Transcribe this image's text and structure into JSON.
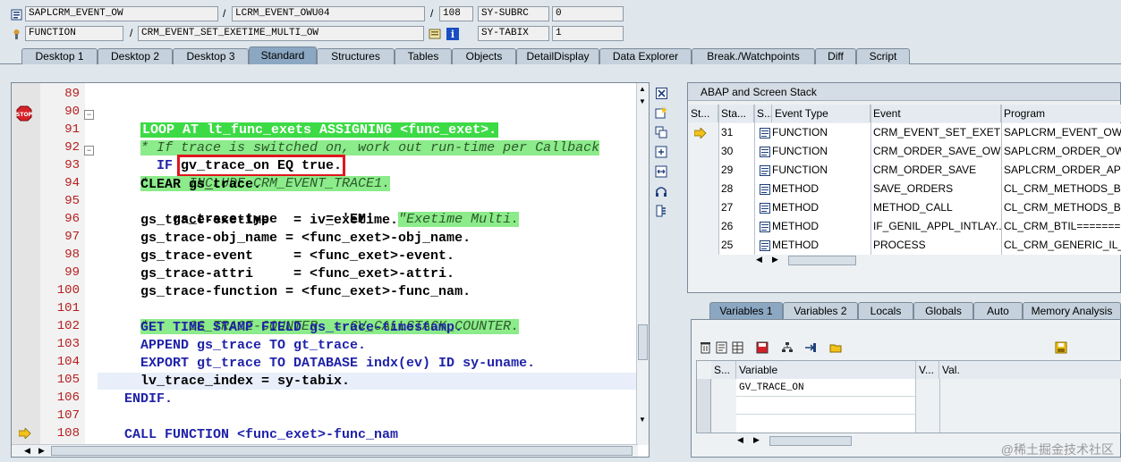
{
  "header": {
    "program": "SAPLCRM_EVENT_OW",
    "include": "LCRM_EVENT_OWU04",
    "line": "108",
    "sy_subrc_label": "SY-SUBRC",
    "sy_subrc_value": "0",
    "type": "FUNCTION",
    "function_name": "CRM_EVENT_SET_EXETIME_MULTI_OW",
    "sy_tabix_label": "SY-TABIX",
    "sy_tabix_value": "1",
    "slash": "/"
  },
  "tabs": [
    {
      "label": "Desktop 1"
    },
    {
      "label": "Desktop 2"
    },
    {
      "label": "Desktop 3"
    },
    {
      "label": "Standard"
    },
    {
      "label": "Structures"
    },
    {
      "label": "Tables"
    },
    {
      "label": "Objects"
    },
    {
      "label": "DetailDisplay"
    },
    {
      "label": "Data Explorer"
    },
    {
      "label": "Break./Watchpoints"
    },
    {
      "label": "Diff"
    },
    {
      "label": "Script"
    }
  ],
  "editor": {
    "lines": [
      {
        "num": "89",
        "code": ""
      },
      {
        "num": "90",
        "code": "LOOP AT lt_func_exets ASSIGNING <func_exet>."
      },
      {
        "num": "91",
        "code": "* If trace is switched on, work out run-time per Callback"
      },
      {
        "num": "92",
        "code_a": "  IF ",
        "code_b": "gv_trace_on EQ true."
      },
      {
        "num": "93",
        "code": "*     INCLUDE CRM_EVENT_TRACE1."
      },
      {
        "num": "94",
        "code": "    CLEAR gs_trace."
      },
      {
        "num": "95",
        "code_a": "    gs_trace-type      = 'EM'.  ",
        "code_b": "\"Exetime Multi."
      },
      {
        "num": "96",
        "code": "    gs_trace-exetime   = iv_exetime."
      },
      {
        "num": "97",
        "code": "    gs_trace-obj_name = <func_exet>-obj_name."
      },
      {
        "num": "98",
        "code": "    gs_trace-event     = <func_exet>-event."
      },
      {
        "num": "99",
        "code": "    gs_trace-attri     = <func_exet>-attri."
      },
      {
        "num": "100",
        "code": "    gs_trace-function = <func_exet>-func_nam."
      },
      {
        "num": "101",
        "code": "*     GS_TRACE-COUNTER  = GV_CALLSTACK_COUNTER."
      },
      {
        "num": "102",
        "code": "    GET TIME STAMP FIELD gs_trace-timestamp."
      },
      {
        "num": "103",
        "code": "    APPEND gs_trace TO gt_trace."
      },
      {
        "num": "104",
        "code": "    EXPORT gt_trace TO DATABASE indx(ev) ID sy-uname."
      },
      {
        "num": "105",
        "code": "    lv_trace_index = sy-tabix."
      },
      {
        "num": "106",
        "code": "  ENDIF."
      },
      {
        "num": "107",
        "code": ""
      },
      {
        "num": "108",
        "code": "  CALL FUNCTION <func_exet>-func_nam"
      }
    ]
  },
  "stack": {
    "title": "ABAP and Screen Stack",
    "columns": [
      "St...",
      "Sta...",
      "S...",
      "Event Type",
      "Event",
      "Program"
    ],
    "rows": [
      {
        "level": "31",
        "type": "FUNCTION",
        "event": "CRM_EVENT_SET_EXETI...",
        "program": "SAPLCRM_EVENT_OW",
        "current": true
      },
      {
        "level": "30",
        "type": "FUNCTION",
        "event": "CRM_ORDER_SAVE_OW",
        "program": "SAPLCRM_ORDER_OW",
        "current": false
      },
      {
        "level": "29",
        "type": "FUNCTION",
        "event": "CRM_ORDER_SAVE",
        "program": "SAPLCRM_ORDER_API",
        "current": false
      },
      {
        "level": "28",
        "type": "METHOD",
        "event": "SAVE_ORDERS",
        "program": "CL_CRM_METHODS_BTIL",
        "current": false
      },
      {
        "level": "27",
        "type": "METHOD",
        "event": "METHOD_CALL",
        "program": "CL_CRM_METHODS_BTIL",
        "current": false
      },
      {
        "level": "26",
        "type": "METHOD",
        "event": "IF_GENIL_APPL_INTLAY...",
        "program": "CL_CRM_BTIL=======",
        "current": false
      },
      {
        "level": "25",
        "type": "METHOD",
        "event": "PROCESS",
        "program": "CL_CRM_GENERIC_IL_NE",
        "current": false
      }
    ]
  },
  "variables": {
    "tabs": [
      {
        "label": "Variables 1"
      },
      {
        "label": "Variables 2"
      },
      {
        "label": "Locals"
      },
      {
        "label": "Globals"
      },
      {
        "label": "Auto"
      },
      {
        "label": "Memory Analysis"
      }
    ],
    "columns": [
      "S...",
      "Variable",
      "V...",
      "Val."
    ],
    "rows": [
      {
        "variable": "GV_TRACE_ON",
        "value": ""
      }
    ]
  },
  "watermark": "@稀土掘金技术社区"
}
